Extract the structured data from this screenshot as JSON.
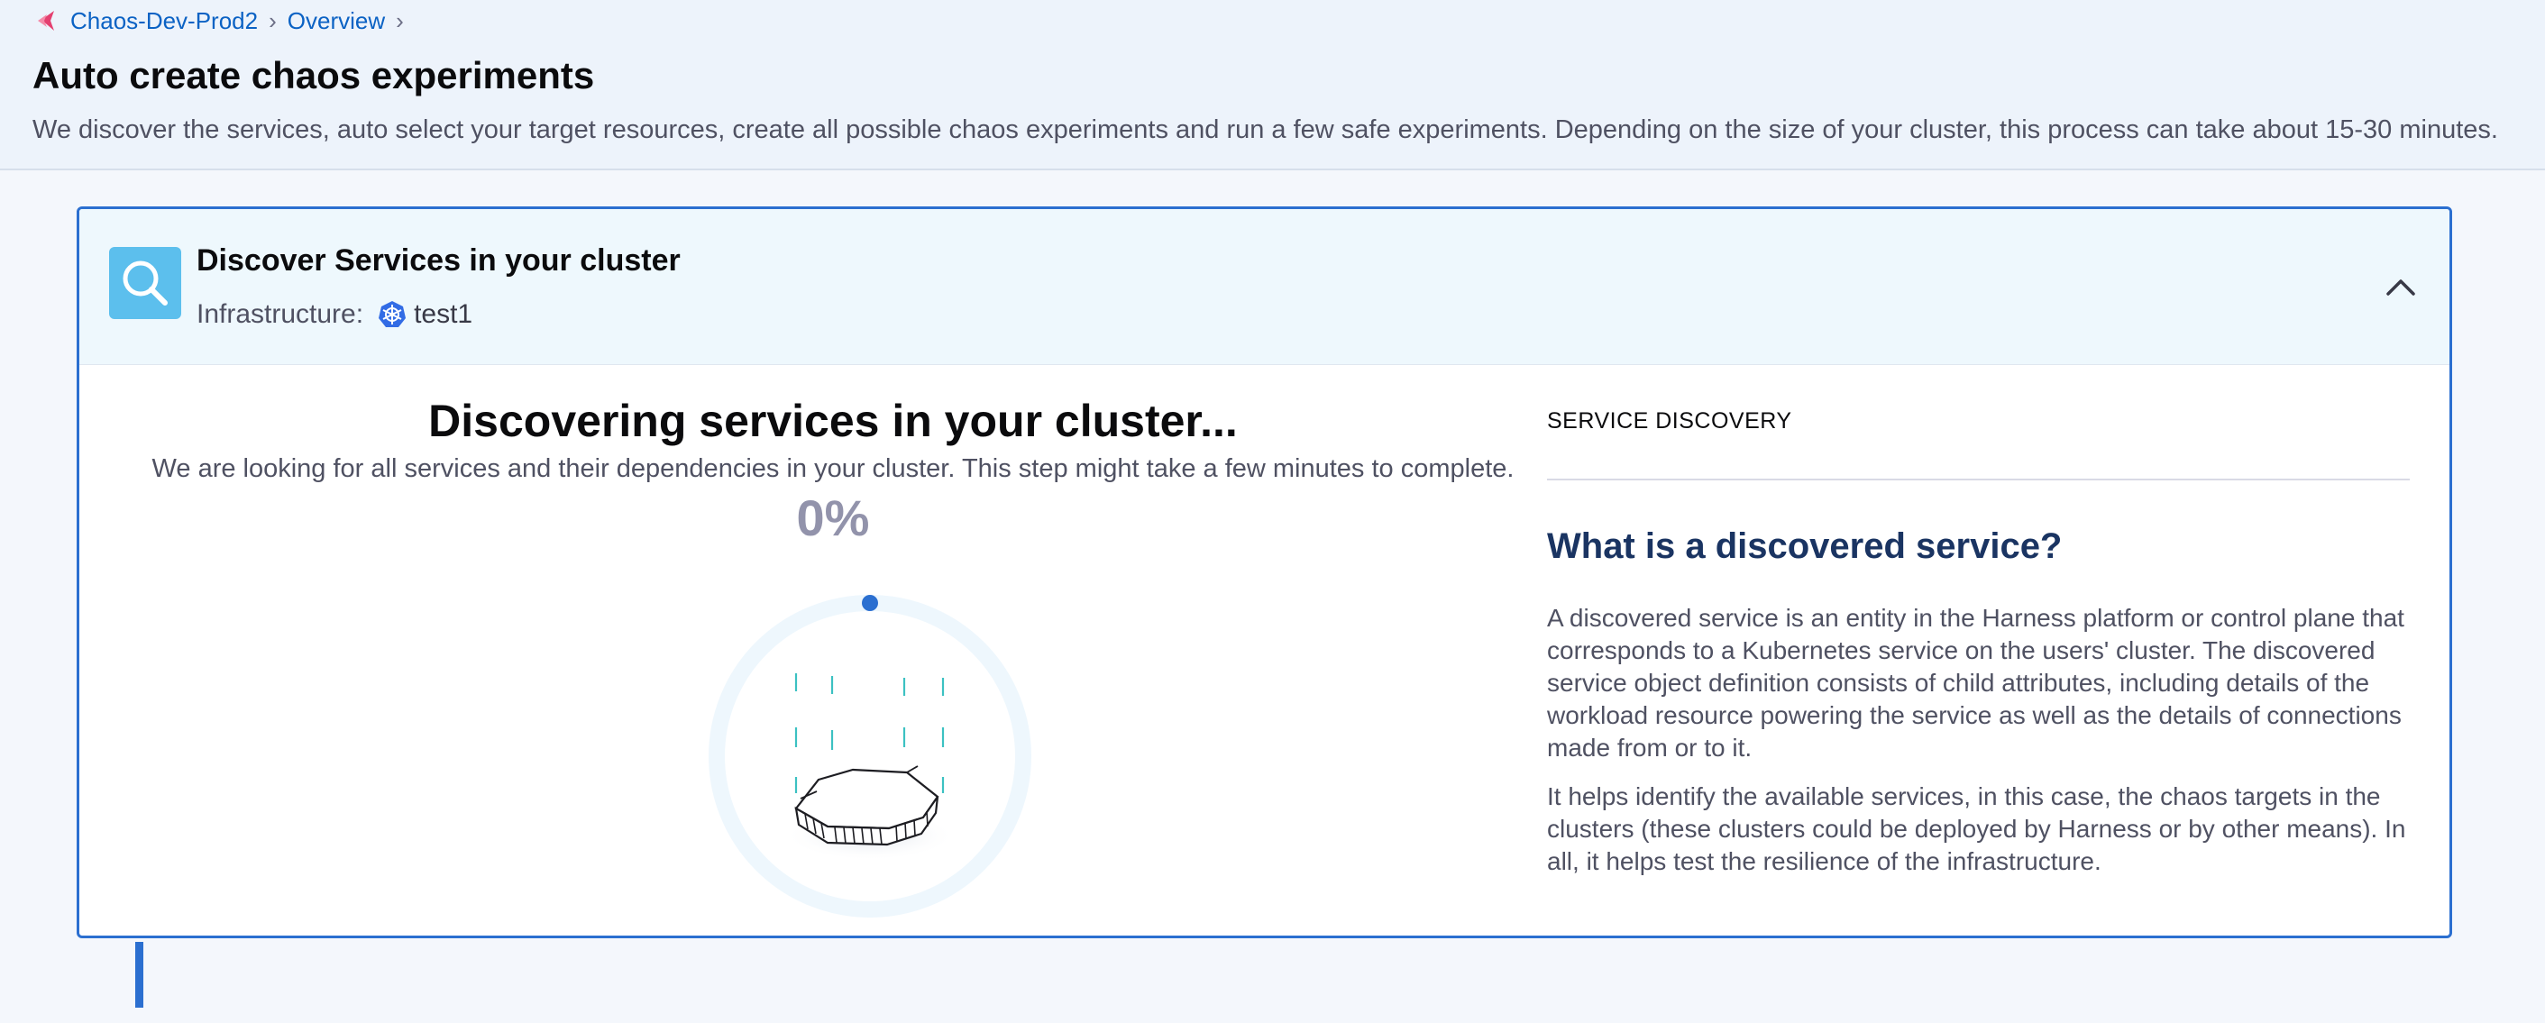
{
  "breadcrumb": {
    "items": [
      "Chaos-Dev-Prod2",
      "Overview"
    ]
  },
  "page": {
    "title": "Auto create chaos experiments",
    "description": "We discover the services, auto select your target resources, create all possible chaos experiments and run a few safe experiments. Depending on the size of your cluster, this process can take about 15-30 minutes."
  },
  "step": {
    "title": "Discover Services in your cluster",
    "infrastructure_label": "Infrastructure:",
    "infrastructure_value": "test1",
    "icon": "search-icon",
    "expanded": true
  },
  "discovery": {
    "title": "Discovering services in your cluster...",
    "subtitle": "We are looking for all services and their dependencies in your cluster. This step might take a few minutes to complete.",
    "progress_text": "0%",
    "progress_fraction": 0
  },
  "info_panel": {
    "label": "SERVICE DISCOVERY",
    "heading": "What is a discovered service?",
    "paragraph_1": "A discovered service is an entity in the Harness platform or control plane that corresponds to a Kubernetes service on the users' cluster. The discovered service object definition consists of child attributes, including details of the workload resource powering the service as well as the details of connections made from or to it.",
    "paragraph_2": "It helps identify the available services, in this case, the chaos targets in the clusters (these clusters could be deployed by Harness or by other means). In all, it helps test the resilience of the infrastructure."
  },
  "colors": {
    "accent": "#2b6fd0",
    "icon_bg": "#5cbfed",
    "heading_navy": "#1a3462",
    "progress_gray": "#9293ab",
    "header_bg": "#edf3fb",
    "card_head_bg": "#eef8fd",
    "rain_teal": "#3cc1c2"
  }
}
